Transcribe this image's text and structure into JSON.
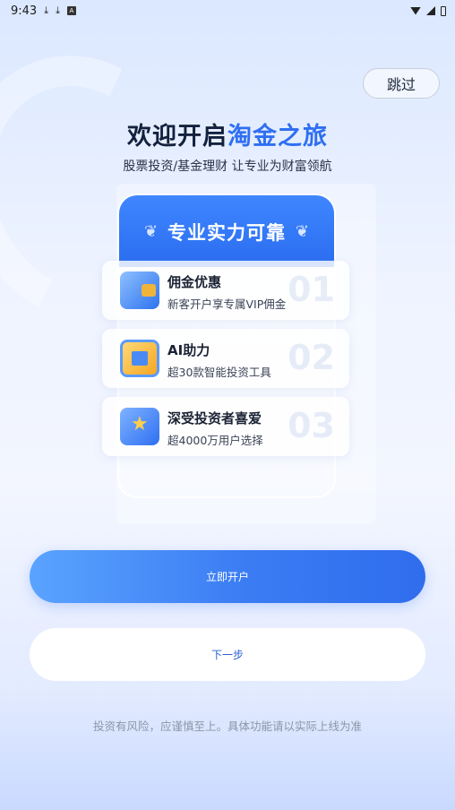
{
  "status_bar": {
    "time": "9:43",
    "left_icons": [
      "download-icon",
      "download-icon",
      "app-a-icon"
    ],
    "right_icons": [
      "wifi-icon",
      "signal-icon",
      "battery-icon"
    ]
  },
  "skip_label": "跳过",
  "headline": {
    "dark": "欢迎开启",
    "blue": "淘金之旅"
  },
  "subtitle": "股票投资/基金理财 让专业为财富领航",
  "card": {
    "title": "专业实力可靠"
  },
  "features": [
    {
      "title": "佣金优惠",
      "desc": "新客开户享专属VIP佣金",
      "num": "01",
      "icon": "wallet-icon"
    },
    {
      "title": "AI助力",
      "desc": "超30款智能投资工具",
      "num": "02",
      "icon": "chip-icon"
    },
    {
      "title": "深受投资者喜爱",
      "desc": "超4000万用户选择",
      "num": "03",
      "icon": "star-badge-icon"
    }
  ],
  "buttons": {
    "open_account": "立即开户",
    "next": "下一步"
  },
  "disclaimer": "投资有风险，应谨慎至上。具体功能请以实际上线为准",
  "colors": {
    "accent": "#2f6ff2",
    "button_gradient_start": "#5aa3ff",
    "button_gradient_end": "#2f6ded"
  }
}
